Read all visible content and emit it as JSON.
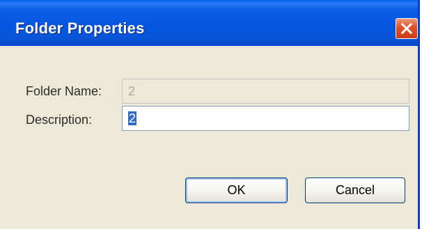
{
  "window": {
    "title": "Folder Properties"
  },
  "form": {
    "folder_name_label": "Folder Name:",
    "folder_name_value": "2",
    "description_label": "Description:",
    "description_value": "2"
  },
  "buttons": {
    "ok_label": "OK",
    "cancel_label": "Cancel"
  },
  "icons": {
    "close": "close-icon"
  },
  "colors": {
    "titlebar": "#0655df",
    "close_button": "#e0562e",
    "dialog_background": "#ece9d8",
    "selection": "#316ac5"
  }
}
